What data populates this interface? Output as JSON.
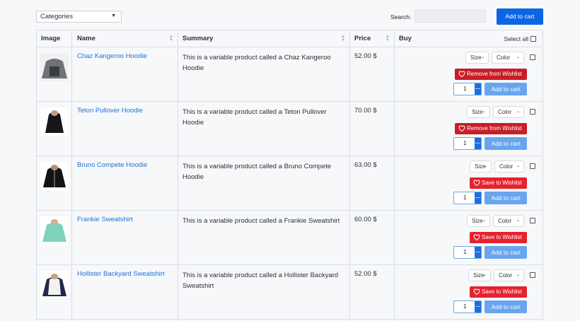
{
  "toolbar": {
    "categories_label": "Categories",
    "search_label": "Search:",
    "search_placeholder": "",
    "add_to_cart_label": "Add to cart"
  },
  "columns": {
    "image": "Image",
    "name": "Name",
    "summary": "Summary",
    "price": "Price",
    "buy": "Buy",
    "select_all": "Select all"
  },
  "rows": [
    {
      "name": "Chaz Kangeroo Hoodie",
      "summary": "This is a variable product called a Chaz Kangeroo Hoodie",
      "price": "52.00 $",
      "size": "Size",
      "color": "Color",
      "wishlist": "Remove from Wishlist",
      "wishlist_type": "remove",
      "qty": "1",
      "add": "Add to cart",
      "thumb": "grey-hoodie-image"
    },
    {
      "name": "Teton Pullover Hoodie",
      "summary": "This is a variable product called a Teton Pullover Hoodie",
      "price": "70.00 $",
      "size": "Size",
      "color": "Color",
      "wishlist": "Remove from Wishlist",
      "wishlist_type": "remove",
      "qty": "1",
      "add": "Add to cart",
      "thumb": "black-hoodie-image"
    },
    {
      "name": "Bruno Compete Hoodie",
      "summary": "This is a variable product called a Bruno Compete Hoodie",
      "price": "63.00 $",
      "size": "Size",
      "color": "Color",
      "wishlist": "Save to Wishlist",
      "wishlist_type": "save",
      "qty": "1",
      "add": "Add to cart",
      "thumb": "black-zip-hoodie-image"
    },
    {
      "name": "Frankie Sweatshirt",
      "summary": "This is a variable product called a Frankie Sweatshirt",
      "price": "60.00 $",
      "size": "Size",
      "color": "Color",
      "wishlist": "Save to Wishlist",
      "wishlist_type": "save",
      "qty": "1",
      "add": "Add to cart",
      "thumb": "mint-sweatshirt-image"
    },
    {
      "name": "Hollister Backyard Sweatshirt",
      "summary": "This is a variable product called a Hollister Backyard Sweatshirt",
      "price": "52.00 $",
      "size": "Size",
      "color": "Color",
      "wishlist": "Save to Wishlist",
      "wishlist_type": "save",
      "qty": "1",
      "add": "Add to cart",
      "thumb": "raglan-sweatshirt-image"
    }
  ],
  "colors": {
    "primary": "#0a66e4",
    "link": "#1d72d4",
    "wishlist_remove": "#c91d27",
    "wishlist_save": "#e6222e",
    "add_to_cart_row": "#69a5ee"
  }
}
